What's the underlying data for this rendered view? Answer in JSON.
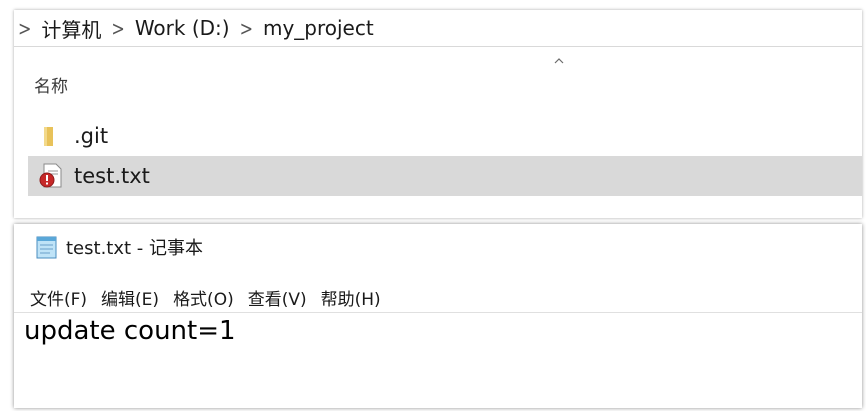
{
  "explorer": {
    "breadcrumb": [
      "计算机",
      "Work (D:)",
      "my_project"
    ],
    "column_header": "名称",
    "files": [
      {
        "name": ".git",
        "icon": "folder-icon",
        "selected": false
      },
      {
        "name": "test.txt",
        "icon": "conflict-text-file-icon",
        "selected": true
      }
    ]
  },
  "notepad": {
    "title": "test.txt - 记事本",
    "menu": [
      "文件(F)",
      "编辑(E)",
      "格式(O)",
      "查看(V)",
      "帮助(H)"
    ],
    "content": "update count=1"
  },
  "colors": {
    "selected_row": "#d9d9d9",
    "folder": "#e8c25a",
    "conflict_badge": "#c62828"
  }
}
